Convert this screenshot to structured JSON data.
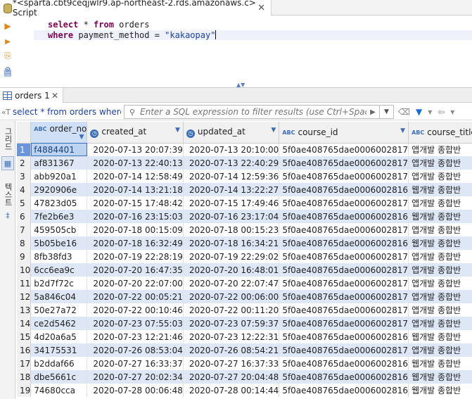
{
  "editor_tab": {
    "title": "*<sparta.cbt9ceqjwlr9.ap-northeast-2.rds.amazonaws.c> Script",
    "close": "✕"
  },
  "left_tools": {
    "run_icon": "▶",
    "run_script_icon": "▶",
    "export_icon": "⎘",
    "format_icon": "⚙",
    "history_icon": "▤"
  },
  "editor": {
    "line1_kw1": "select",
    "line1_rest": " * ",
    "line1_kw2": "from",
    "line1_tbl": " orders",
    "line2_kw": "where",
    "line2_rest": " payment_method = ",
    "line2_str": "\"kakaopay\""
  },
  "results_tab": {
    "label": "orders 1",
    "close": "✕"
  },
  "filter": {
    "query_prefix": "«T",
    "query": "select * from orders where p",
    "placeholder": "Enter a SQL expression to filter results (use Ctrl+Space)"
  },
  "side_panel": {
    "grid_label": "그리드",
    "text_label": "텍스트"
  },
  "columns": [
    {
      "name": "order_no",
      "type": "ABC"
    },
    {
      "name": "created_at",
      "type": "clock"
    },
    {
      "name": "updated_at",
      "type": "clock"
    },
    {
      "name": "course_id",
      "type": "ABC"
    },
    {
      "name": "course_title",
      "type": "ABC"
    }
  ],
  "rows": [
    [
      "1",
      "f4884401",
      "2020-07-13 20:07:39",
      "2020-07-13 20:10:00",
      "5f0ae408765dae0006002817",
      "앱개발 종합반"
    ],
    [
      "2",
      "af831367",
      "2020-07-13 22:40:13",
      "2020-07-13 22:40:29",
      "5f0ae408765dae0006002817",
      "앱개발 종합반"
    ],
    [
      "3",
      "abb920a1",
      "2020-07-14 12:58:49",
      "2020-07-14 12:59:36",
      "5f0ae408765dae0006002817",
      "앱개발 종합반"
    ],
    [
      "4",
      "2920906e",
      "2020-07-14 13:21:18",
      "2020-07-14 13:22:27",
      "5f0ae408765dae0006002816",
      "웹개발 종합반"
    ],
    [
      "5",
      "47823d05",
      "2020-07-15 17:48:42",
      "2020-07-15 17:49:46",
      "5f0ae408765dae0006002817",
      "앱개발 종합반"
    ],
    [
      "6",
      "7fe2b6e3",
      "2020-07-16 23:15:03",
      "2020-07-16 23:17:04",
      "5f0ae408765dae0006002816",
      "웹개발 종합반"
    ],
    [
      "7",
      "459505cb",
      "2020-07-18 00:15:09",
      "2020-07-18 00:15:23",
      "5f0ae408765dae0006002817",
      "앱개발 종합반"
    ],
    [
      "8",
      "5b05be16",
      "2020-07-18 16:32:49",
      "2020-07-18 16:34:21",
      "5f0ae408765dae0006002816",
      "웹개발 종합반"
    ],
    [
      "9",
      "8fb38fd3",
      "2020-07-19 22:28:19",
      "2020-07-19 22:29:02",
      "5f0ae408765dae0006002817",
      "앱개발 종합반"
    ],
    [
      "10",
      "6cc6ea9c",
      "2020-07-20 16:47:35",
      "2020-07-20 16:48:01",
      "5f0ae408765dae0006002817",
      "앱개발 종합반"
    ],
    [
      "11",
      "b2d7f72c",
      "2020-07-20 22:07:00",
      "2020-07-20 22:07:47",
      "5f0ae408765dae0006002817",
      "앱개발 종합반"
    ],
    [
      "12",
      "5a846c04",
      "2020-07-22 00:05:21",
      "2020-07-22 00:06:00",
      "5f0ae408765dae0006002817",
      "앱개발 종합반"
    ],
    [
      "13",
      "50e27a72",
      "2020-07-22 00:10:46",
      "2020-07-22 00:11:20",
      "5f0ae408765dae0006002817",
      "앱개발 종합반"
    ],
    [
      "14",
      "ce2d5462",
      "2020-07-23 07:55:03",
      "2020-07-23 07:59:37",
      "5f0ae408765dae0006002817",
      "앱개발 종합반"
    ],
    [
      "15",
      "4d20a6a5",
      "2020-07-23 12:21:46",
      "2020-07-23 12:22:31",
      "5f0ae408765dae0006002816",
      "웹개발 종합반"
    ],
    [
      "16",
      "34175531",
      "2020-07-26 08:53:04",
      "2020-07-26 08:54:21",
      "5f0ae408765dae0006002817",
      "앱개발 종합반"
    ],
    [
      "17",
      "b2ddaf66",
      "2020-07-27 16:33:37",
      "2020-07-27 16:37:33",
      "5f0ae408765dae0006002816",
      "웹개발 종합반"
    ],
    [
      "18",
      "dbe5661c",
      "2020-07-27 20:02:34",
      "2020-07-27 20:04:48",
      "5f0ae408765dae0006002816",
      "웹개발 종합반"
    ],
    [
      "19",
      "74680cca",
      "2020-07-28 00:06:48",
      "2020-07-28 00:14:44",
      "5f0ae408765dae0006002816",
      "웹개발 종합반"
    ]
  ],
  "colors": {
    "keyword": "#7f0055",
    "string": "#1b3ea8",
    "row_alt": "#dde7f5",
    "selection": "#3b6fb8"
  }
}
